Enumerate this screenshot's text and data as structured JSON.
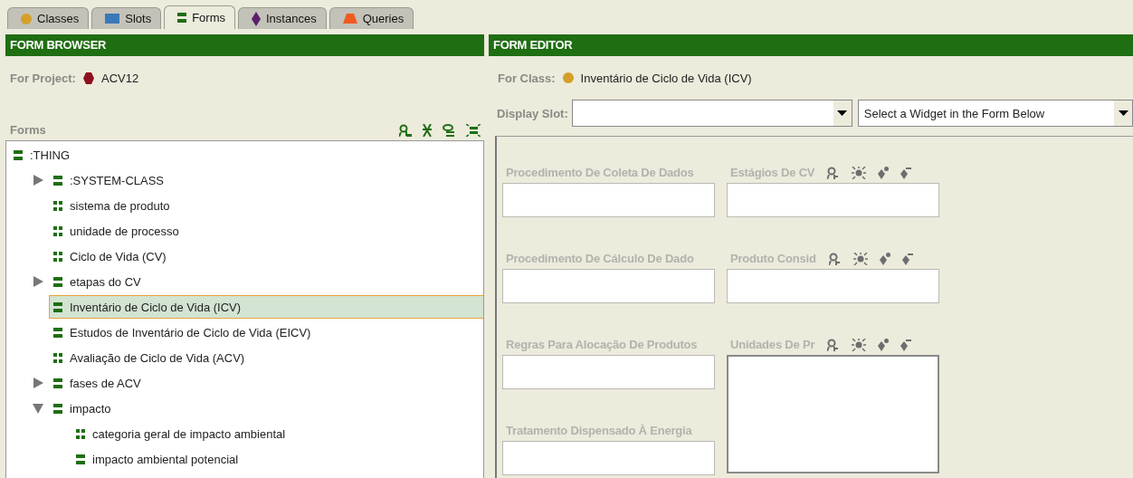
{
  "tabs": [
    {
      "label": "Classes",
      "selected": false
    },
    {
      "label": "Slots",
      "selected": false
    },
    {
      "label": "Forms",
      "selected": true
    },
    {
      "label": "Instances",
      "selected": false
    },
    {
      "label": "Queries",
      "selected": false
    }
  ],
  "form_browser": {
    "title": "FORM BROWSER",
    "project_label": "For Project:",
    "project": "ACV12",
    "forms_label": "Forms",
    "tree": [
      {
        "label": ":THING",
        "kind": "bars",
        "selected": false,
        "children": [
          {
            "label": ":SYSTEM-CLASS",
            "kind": "bars",
            "expanded": false,
            "selected": false
          },
          {
            "label": "sistema de produto",
            "kind": "grid",
            "selected": false
          },
          {
            "label": "unidade de processo",
            "kind": "grid",
            "selected": false
          },
          {
            "label": "Ciclo de Vida (CV)",
            "kind": "grid",
            "selected": false
          },
          {
            "label": "etapas do CV",
            "kind": "bars",
            "expanded": false,
            "selected": false
          },
          {
            "label": "Inventário de Ciclo de Vida (ICV)",
            "kind": "bars",
            "selected": true
          },
          {
            "label": "Estudos de Inventário de Ciclo de Vida (EICV)",
            "kind": "bars",
            "selected": false
          },
          {
            "label": "Avaliação de Ciclo de Vida (ACV)",
            "kind": "grid",
            "selected": false
          },
          {
            "label": "fases de ACV",
            "kind": "bars",
            "expanded": false,
            "selected": false
          },
          {
            "label": "impacto",
            "kind": "bars",
            "expanded": true,
            "selected": false,
            "children": [
              {
                "label": "categoria geral de impacto ambiental",
                "kind": "grid",
                "selected": false
              },
              {
                "label": "impacto ambiental potencial",
                "kind": "bars",
                "selected": false
              }
            ]
          }
        ]
      }
    ]
  },
  "form_editor": {
    "title": "FORM EDITOR",
    "class_label": "For Class:",
    "class_name": "Inventário de Ciclo de Vida (ICV)",
    "display_slot_label": "Display Slot:",
    "widget_select": "Select a Widget in the Form Below",
    "widgets": [
      {
        "label": "Procedimento De Coleta De Dados",
        "kind": "text"
      },
      {
        "label": "Estágios De CV",
        "kind": "text",
        "tools": true
      },
      {
        "label": "Procedimento De Cálculo De Dado",
        "kind": "text"
      },
      {
        "label": "Produto Consid",
        "kind": "text",
        "tools": true
      },
      {
        "label": "Regras Para Alocação De Produtos",
        "kind": "text"
      },
      {
        "label": "Unidades De Pr",
        "kind": "list",
        "tools": true
      },
      {
        "label": "Tratamento Dispensado À Energia",
        "kind": "text"
      }
    ]
  }
}
